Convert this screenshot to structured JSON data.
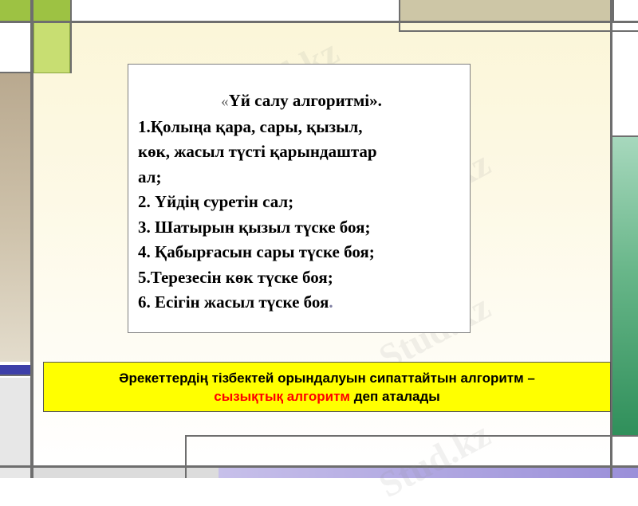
{
  "card": {
    "title_open": "«",
    "title_text": "Үй салу алгоритмі».",
    "line1a": "1.Қолыңа қара, сары, қызыл,",
    "line1b": "көк, жасыл түсті қарындаштар",
    "line1c": "ал;",
    "step2": "2. Үйдің суретін сал;",
    "step3": "3. Шатырын қызыл түске боя;",
    "step4": "4. Қабырғасын сары түске боя;",
    "step5": "5.Терезесін көк түске боя;",
    "step6_text": "6. Есігін жасыл түске боя",
    "step6_dot": "."
  },
  "banner": {
    "line1": "Әрекеттердің тізбектей орындалуын сипаттайтын алгоритм –",
    "highlight": "сызықтық алгоритм",
    "line2_tail": " деп аталады"
  },
  "watermark": {
    "text": "Stud.kz"
  },
  "colors": {
    "accent_green": "#9dc243",
    "banner_yellow": "#ffff00",
    "highlight_red": "#ff0000",
    "tan": "#cdc6a6",
    "right_green": "#2f8f5a"
  }
}
